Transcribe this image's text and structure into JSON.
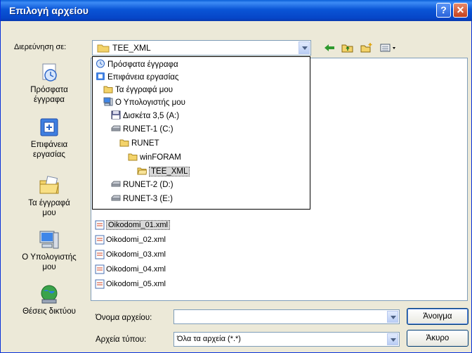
{
  "window": {
    "title": "Επιλογή αρχείου",
    "help_glyph": "?",
    "close_glyph": "✕"
  },
  "toolbar": {
    "look_in_label": "Διερεύνηση σε:",
    "look_in_value": "TEE_XML"
  },
  "places": [
    {
      "label_line1": "Πρόσφατα",
      "label_line2": "έγγραφα",
      "icon": "recent-documents-icon"
    },
    {
      "label_line1": "Επιφάνεια",
      "label_line2": "εργασίας",
      "icon": "desktop-icon"
    },
    {
      "label_line1": "Τα έγγραφά",
      "label_line2": "μου",
      "icon": "my-documents-icon"
    },
    {
      "label_line1": "Ο Υπολογιστής",
      "label_line2": "μου",
      "icon": "my-computer-icon"
    },
    {
      "label_line1": "Θέσεις δικτύου",
      "label_line2": "",
      "icon": "network-places-icon"
    }
  ],
  "dropdown_items": [
    {
      "label": "Πρόσφατα έγγραφα",
      "icon": "recent-documents-icon"
    },
    {
      "label": "Επιφάνεια εργασίας",
      "icon": "desktop-icon"
    },
    {
      "label": "Τα έγγραφά μου",
      "icon": "folder-icon"
    },
    {
      "label": "Ο Υπολογιστής μου",
      "icon": "my-computer-icon"
    },
    {
      "label": "Δισκέτα 3,5 (A:)",
      "icon": "floppy-icon"
    },
    {
      "label": "RUNET-1 (C:)",
      "icon": "drive-icon"
    },
    {
      "label": "RUNET",
      "icon": "folder-icon"
    },
    {
      "label": "winFORAM",
      "icon": "folder-icon"
    },
    {
      "label": "TEE_XML",
      "icon": "folder-open-icon"
    },
    {
      "label": "RUNET-2 (D:)",
      "icon": "drive-icon"
    },
    {
      "label": "RUNET-3 (E:)",
      "icon": "drive-icon"
    }
  ],
  "files": [
    "Oikodomi_01.xml",
    "Oikodomi_02.xml",
    "Oikodomi_03.xml",
    "Oikodomi_04.xml",
    "Oikodomi_05.xml"
  ],
  "bottom": {
    "filename_label": "Όνομα αρχείου:",
    "filename_value": "",
    "filetype_label": "Αρχεία τύπου:",
    "filetype_value": "Όλα τα αρχεία (*.*)",
    "open_button": "Άνοιγμα",
    "cancel_button": "Άκυρο"
  }
}
